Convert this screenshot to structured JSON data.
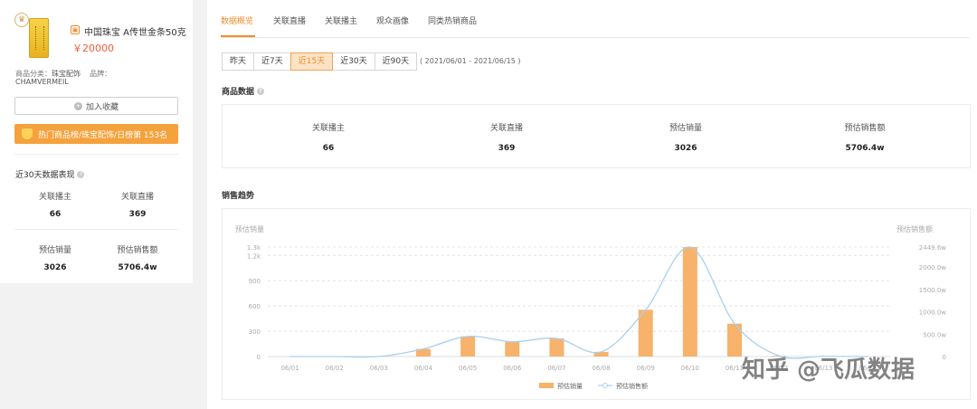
{
  "product": {
    "title": "中国珠宝 A传世金条50克",
    "price": "￥20000",
    "category_label": "商品分类：",
    "category_value": "珠宝配饰",
    "brand_label": "品牌：",
    "brand_value": "CHAMVERMEIL",
    "favorite_label": "加入收藏",
    "rank_label": "热门商品榜/珠宝配饰/日榜第 153名"
  },
  "recent30": {
    "title": "近30天数据表现",
    "items": [
      {
        "label": "关联播主",
        "value": "66"
      },
      {
        "label": "关联直播",
        "value": "369"
      },
      {
        "label": "预估销量",
        "value": "3026"
      },
      {
        "label": "预估销售额",
        "value": "5706.4w"
      }
    ]
  },
  "tabs": [
    "数据概览",
    "关联直播",
    "关联播主",
    "观众画像",
    "同类热销商品"
  ],
  "periods": [
    "昨天",
    "近7天",
    "近15天",
    "近30天",
    "近90天"
  ],
  "active_period_index": 2,
  "date_range": "( 2021/06/01 - 2021/06/15 )",
  "goods_data": {
    "title": "商品数据",
    "stats": [
      {
        "label": "关联播主",
        "value": "66"
      },
      {
        "label": "关联直播",
        "value": "369"
      },
      {
        "label": "预估销量",
        "value": "3026"
      },
      {
        "label": "预估销售额",
        "value": "5706.4w"
      }
    ]
  },
  "sales_trend": {
    "title": "销售趋势"
  },
  "colors": {
    "accent": "#f08c2b",
    "bar": "#f7b26b",
    "line": "#a8d0f0"
  },
  "watermark": "知乎 @飞瓜数据",
  "chart_data": {
    "type": "bar",
    "left_axis_label": "预估销量",
    "right_axis_label": "预估销售额",
    "categories": [
      "06/01",
      "06/02",
      "06/03",
      "06/04",
      "06/05",
      "06/06",
      "06/07",
      "06/08",
      "06/09",
      "06/10",
      "06/11",
      "06/12",
      "06/13",
      "06/14"
    ],
    "left_ticks": [
      "0",
      "300",
      "600",
      "900",
      "1.2k",
      "1.3k"
    ],
    "left_tick_values": [
      0,
      300,
      600,
      900,
      1200,
      1300
    ],
    "right_ticks": [
      "0",
      "500.0w",
      "1000.0w",
      "1500.0w",
      "2000.0w",
      "2449.6w"
    ],
    "right_tick_values": [
      0,
      500,
      1000,
      1500,
      2000,
      2449.6
    ],
    "ylim_left": [
      0,
      1300
    ],
    "ylim_right": [
      0,
      2449.6
    ],
    "series": [
      {
        "name": "预估销量",
        "kind": "bar",
        "values": [
          0,
          0,
          0,
          90,
          240,
          175,
          215,
          55,
          555,
          1300,
          390,
          8,
          3,
          0
        ]
      },
      {
        "name": "预估销售额",
        "kind": "line",
        "values": [
          0,
          0,
          0,
          170,
          450,
          330,
          405,
          105,
          1045,
          2449.6,
          735,
          15,
          5,
          0
        ]
      }
    ],
    "legend": "bottom"
  }
}
